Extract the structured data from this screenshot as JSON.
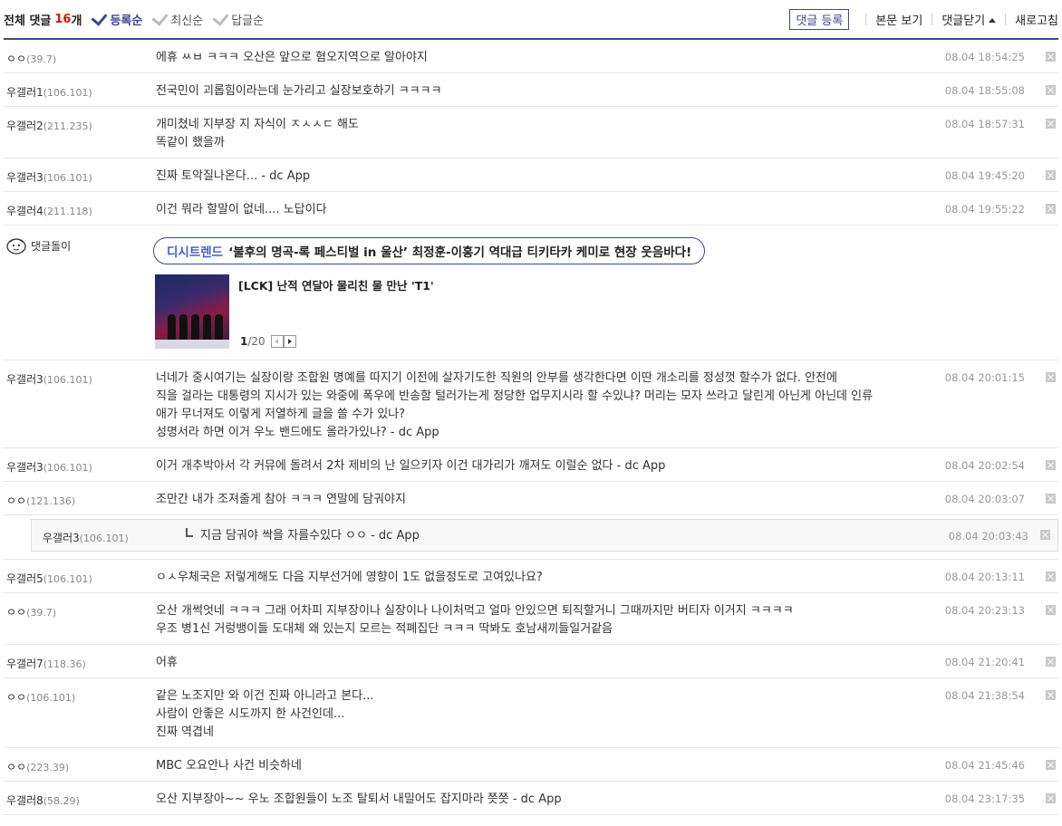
{
  "header": {
    "title": "전체 댓글",
    "count": "16",
    "unit": "개",
    "sort_options": [
      {
        "label": "등록순",
        "active": true
      },
      {
        "label": "최신순",
        "active": false
      },
      {
        "label": "답글순",
        "active": false
      }
    ],
    "register_label": "댓글 등록",
    "view_body_label": "본문 보기",
    "close_comments_label": "댓글닫기",
    "refresh_label": "새로고침"
  },
  "comments": [
    {
      "nick": "ㅇㅇ",
      "ip": "(39.7)",
      "lines": [
        "에휴 ㅆㅂ ㅋㅋㅋ 오산은 앞으로 혐오지역으로 알아야지"
      ],
      "date": "08.04 18:54:25"
    },
    {
      "nick": "우갤러1",
      "ip": "(106.101)",
      "lines": [
        "전국민이 괴롭힘이라는데 눈가리고 실장보호하기 ㅋㅋㅋㅋ"
      ],
      "date": "08.04 18:55:08"
    },
    {
      "nick": "우갤러2",
      "ip": "(211.235)",
      "lines": [
        "개미쳤네 지부장 지 자식이 ㅈㅅㅅㄷ 해도",
        "똑같이 했을까"
      ],
      "date": "08.04 18:57:31"
    },
    {
      "nick": "우갤러3",
      "ip": "(106.101)",
      "lines": [
        "진짜 토악질나온다... - dc App"
      ],
      "date": "08.04 19:45:20"
    },
    {
      "nick": "우갤러4",
      "ip": "(211.118)",
      "lines": [
        "이건 뭐라 할말이 없네.... 노답이다"
      ],
      "date": "08.04 19:55:22"
    }
  ],
  "bot": {
    "name": "댓글돌이",
    "trend_tag": "디시트렌드",
    "trend_text": "‘불후의 명곡-록 페스티벌 in 울산’ 최정훈-이홍기 역대급 티키타카 케미로 현장 웃음바다!",
    "news_title": "[LCK] 난적 연달아 물리친 물 만난 'T1'",
    "page_current": "1",
    "page_total": "/20"
  },
  "comments2": [
    {
      "nick": "우갤러3",
      "ip": "(106.101)",
      "lines": [
        "너네가 중시여기는 실장이랑 조합원 명예를 따지기 이전에 살자기도한 직원의 안부를 생각한다면 이딴 개소리를 정성껏 할수가 없다. 안전에",
        "직을 걸라는 대통령의 지시가 있는 와중에 폭우에 반송함 털러가는게 정당한 업무지시라 할 수있냐? 머리는 모자 쓰라고 달린게 아닌게 아닌데 인류",
        "애가 무너져도 이렇게 저열하게 글을 쓸 수가 있나?",
        "성명서라 하면 이거 우노 밴드에도 올라가있나? - dc App"
      ],
      "date": "08.04 20:01:15"
    },
    {
      "nick": "우갤러3",
      "ip": "(106.101)",
      "lines": [
        "이거 개추박아서 각 커뮤에 돌려서 2차 제비의 난 일으키자 이건 대가리가 깨져도 이럴순 없다 - dc App"
      ],
      "date": "08.04 20:02:54"
    },
    {
      "nick": "ㅇㅇ",
      "ip": "(121.136)",
      "lines": [
        "조만간 내가 조져줄게 참아 ㅋㅋㅋ 연말에 담궈야지"
      ],
      "date": "08.04 20:03:07"
    }
  ],
  "reply": {
    "nick": "우갤러3",
    "ip": "(106.101)",
    "text": "지금 담궈야 싹을 자를수있다 ㅇㅇ - dc App",
    "date": "08.04 20:03:43"
  },
  "comments3": [
    {
      "nick": "우갤러5",
      "ip": "(106.101)",
      "lines": [
        "ㅇㅅ우체국은 저렇게해도 다음 지부선거에 영향이 1도 없을정도로 고여있나요?"
      ],
      "date": "08.04 20:13:11"
    },
    {
      "nick": "ㅇㅇ",
      "ip": "(39.7)",
      "lines": [
        "오산 개썩엇네 ㅋㅋㅋ 그래 어차피 지부장이나 실장이나 나이처먹고 얼마 안있으면 퇴직할거니 그때까지만 버티자 이거지 ㅋㅋㅋㅋ",
        "우조 병1신 거렁뱅이들 도대체 왜 있는지 모르는 적폐집단 ㅋㅋㅋ 딱봐도 호남새끼들일거같음"
      ],
      "date": "08.04 20:23:13"
    },
    {
      "nick": "우갤러7",
      "ip": "(118.36)",
      "lines": [
        "어휴"
      ],
      "date": "08.04 21:20:41"
    },
    {
      "nick": "ㅇㅇ",
      "ip": "(106.101)",
      "lines": [
        "같은 노조지만 와 이건 진짜 아니라고 본다...",
        "사람이 안좋은 시도까지 한 사건인데...",
        "진짜 역겹네"
      ],
      "date": "08.04 21:38:54"
    },
    {
      "nick": "ㅇㅇ",
      "ip": "(223.39)",
      "lines": [
        "MBC 오요안나 사건 비슷하네"
      ],
      "date": "08.04 21:45:46"
    },
    {
      "nick": "우갤러8",
      "ip": "(58.29)",
      "lines": [
        "오산 지부장아~~ 우노 조합원들이 노조 탈퇴서 내밀어도 잡지마라 쯧쯧 - dc App"
      ],
      "date": "08.04 23:17:35"
    }
  ]
}
